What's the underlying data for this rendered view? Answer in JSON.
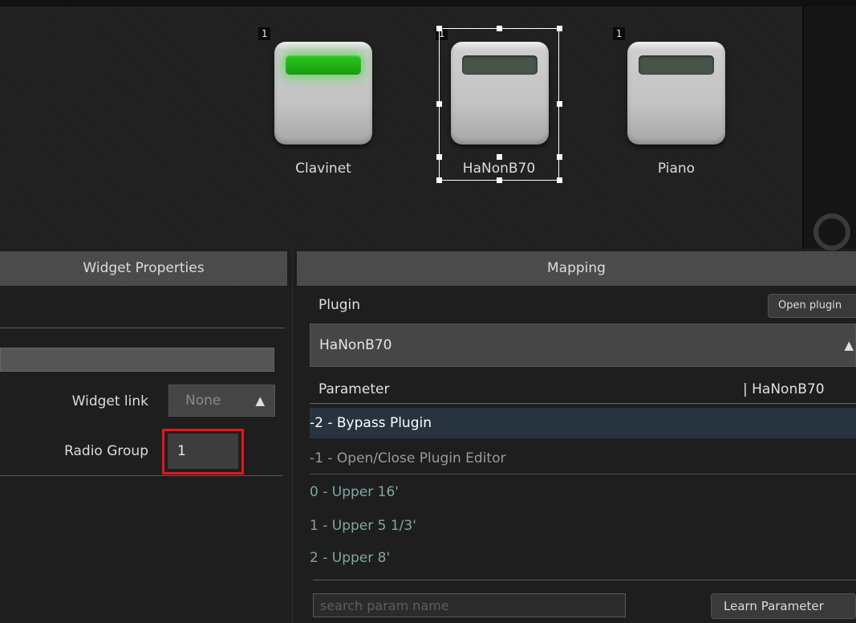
{
  "canvas": {
    "widgets": [
      {
        "label": "Clavinet",
        "badge": "1",
        "led_on": true
      },
      {
        "label": "HaNonB70",
        "badge": "1",
        "led_on": false,
        "selected": true
      },
      {
        "label": "Piano",
        "badge": "1",
        "led_on": false
      }
    ]
  },
  "widget_properties": {
    "title": "Widget Properties",
    "widget_link_label": "Widget link",
    "widget_link_value": "None",
    "radio_group_label": "Radio Group",
    "radio_group_value": "1"
  },
  "mapping": {
    "title": "Mapping",
    "plugin_label": "Plugin",
    "open_plugin_button": "Open plugin",
    "plugin_value": "HaNonB70",
    "parameter_header": "Parameter",
    "parameter_header_right": "| HaNonB70",
    "parameters": [
      {
        "text": "-2 - Bypass Plugin",
        "state": "selected"
      },
      {
        "text": "-1 - Open/Close Plugin Editor",
        "state": "dim"
      },
      {
        "text": "0 - Upper 16'",
        "state": "teal"
      },
      {
        "text": "1 - Upper 5 1/3'",
        "state": "teal"
      },
      {
        "text": "2 - Upper 8'",
        "state": "teal"
      }
    ],
    "search_placeholder": "search param name",
    "learn_button": "Learn Parameter"
  },
  "colors": {
    "led_on": "#28c81c",
    "selection_row": "#27343f",
    "highlight_box": "#e01818",
    "teal_text": "#7fa7a4"
  }
}
